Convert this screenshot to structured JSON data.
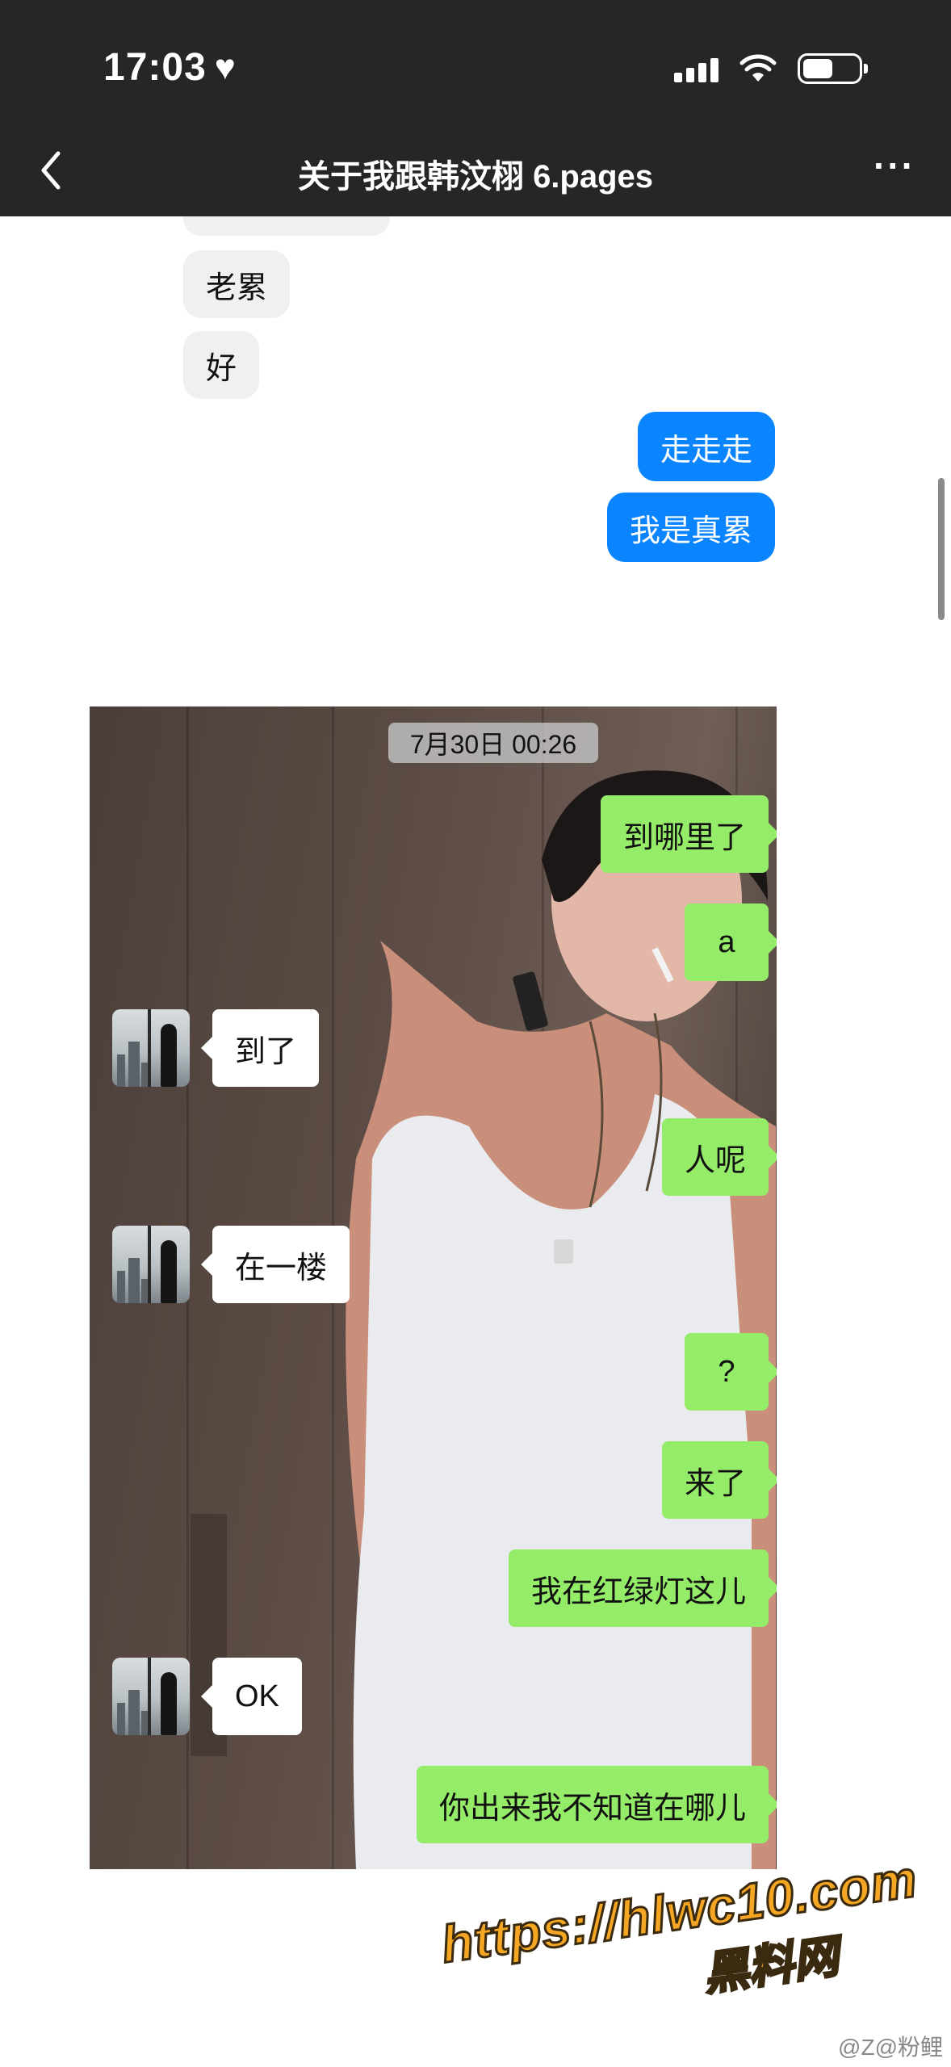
{
  "status_bar": {
    "time": "17:03",
    "heart_icon": "heart-icon",
    "battery_level": 0.4
  },
  "nav": {
    "back_icon": "chevron-left-icon",
    "title": "关于我跟韩汶栩 6.pages",
    "more_icon": "more-dots-icon"
  },
  "doc": {
    "received": [
      "老累",
      "好"
    ],
    "sent": [
      "走走走",
      "我是真累"
    ]
  },
  "screenshot": {
    "timestamp": "7月30日 00:26",
    "messages": [
      {
        "side": "right",
        "text": "到哪里了"
      },
      {
        "side": "right",
        "text": "a"
      },
      {
        "side": "left",
        "text": "到了"
      },
      {
        "side": "right",
        "text": "人呢"
      },
      {
        "side": "left",
        "text": "在一楼"
      },
      {
        "side": "right",
        "text": "?"
      },
      {
        "side": "right",
        "text": "来了"
      },
      {
        "side": "right",
        "text": "我在红绿灯这儿"
      },
      {
        "side": "left",
        "text": "OK"
      },
      {
        "side": "right",
        "text": "你出来我不知道在哪儿"
      }
    ]
  },
  "watermark": {
    "url": "https://hlwc10.com",
    "site": "黑料网",
    "weibo": "@Z@粉鲤"
  },
  "colors": {
    "chrome": "#262626",
    "blue_bubble": "#0a84ff",
    "green_bubble": "#95ec69",
    "watermark": "#f5a623"
  }
}
